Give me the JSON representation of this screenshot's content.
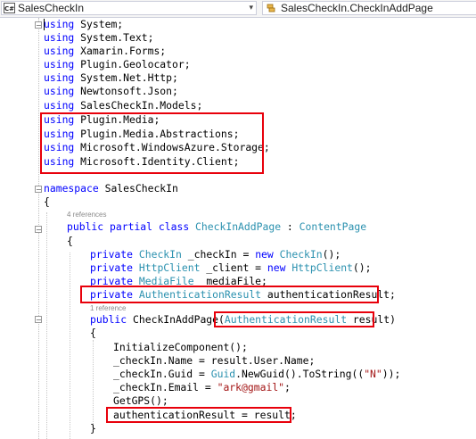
{
  "navbar": {
    "project": "SalesCheckIn",
    "member": "SalesCheckIn.CheckInAddPage",
    "project_icon": "csharp-file-icon",
    "member_icon": "class-icon"
  },
  "code": {
    "usings": [
      [
        "using",
        " System;"
      ],
      [
        "using",
        " System.Text;"
      ],
      [
        "using",
        " Xamarin.Forms;"
      ],
      [
        "using",
        " Plugin.Geolocator;"
      ],
      [
        "using",
        " System.Net.Http;"
      ],
      [
        "using",
        " Newtonsoft.Json;"
      ],
      [
        "using",
        " SalesCheckIn.Models;"
      ],
      [
        "using",
        " Plugin.Media;"
      ],
      [
        "using",
        " Plugin.Media.Abstractions;"
      ],
      [
        "using",
        " Microsoft.WindowsAzure.Storage;"
      ],
      [
        "using",
        " Microsoft.Identity.Client;"
      ]
    ],
    "namespace_kw": "namespace",
    "namespace_name": " SalesCheckIn",
    "open_brace": "{",
    "close_brace": "}",
    "class_refs": "4 references",
    "class_public": "public",
    "class_partial": "partial",
    "class_kw": "class",
    "class_name": "CheckInAddPage",
    "class_colon": " : ",
    "class_base": "ContentPage",
    "fields": [
      {
        "kw": "private",
        "type": "CheckIn",
        "rest": " _checkIn = ",
        "kw2": "new",
        "type2": "CheckIn",
        "tail": "();"
      },
      {
        "kw": "private",
        "type": "HttpClient",
        "rest": " _client = ",
        "kw2": "new",
        "type2": "HttpClient",
        "tail": "();"
      },
      {
        "kw": "private",
        "type": "MediaFile",
        "rest": "  mediaFile;",
        "kw2": "",
        "type2": "",
        "tail": ""
      },
      {
        "kw": "private",
        "type": "AuthenticationResult",
        "rest": " authenticationResult;",
        "kw2": "",
        "type2": "",
        "tail": ""
      }
    ],
    "ctor_refs": "1 reference",
    "ctor_public": "public",
    "ctor_name": " CheckInAddPage(",
    "ctor_param_type": "AuthenticationResult",
    "ctor_param_name": " result",
    "ctor_close": ")",
    "body": [
      "InitializeComponent();",
      "_checkIn.Name = result.User.Name;",
      "_checkIn.Guid = ",
      "_checkIn.Email = ",
      "GetGPS();",
      "authenticationResult = result;"
    ],
    "guid_type": "Guid",
    "guid_rest": ".NewGuid().ToString((",
    "guid_str": "\"N\"",
    "guid_end": "));",
    "email_str": "\"ark@gmail\"",
    "email_end": ";"
  },
  "colors": {
    "keyword": "#0000ff",
    "type": "#2b91af",
    "string": "#a31515",
    "highlight_box": "#e8000b"
  }
}
